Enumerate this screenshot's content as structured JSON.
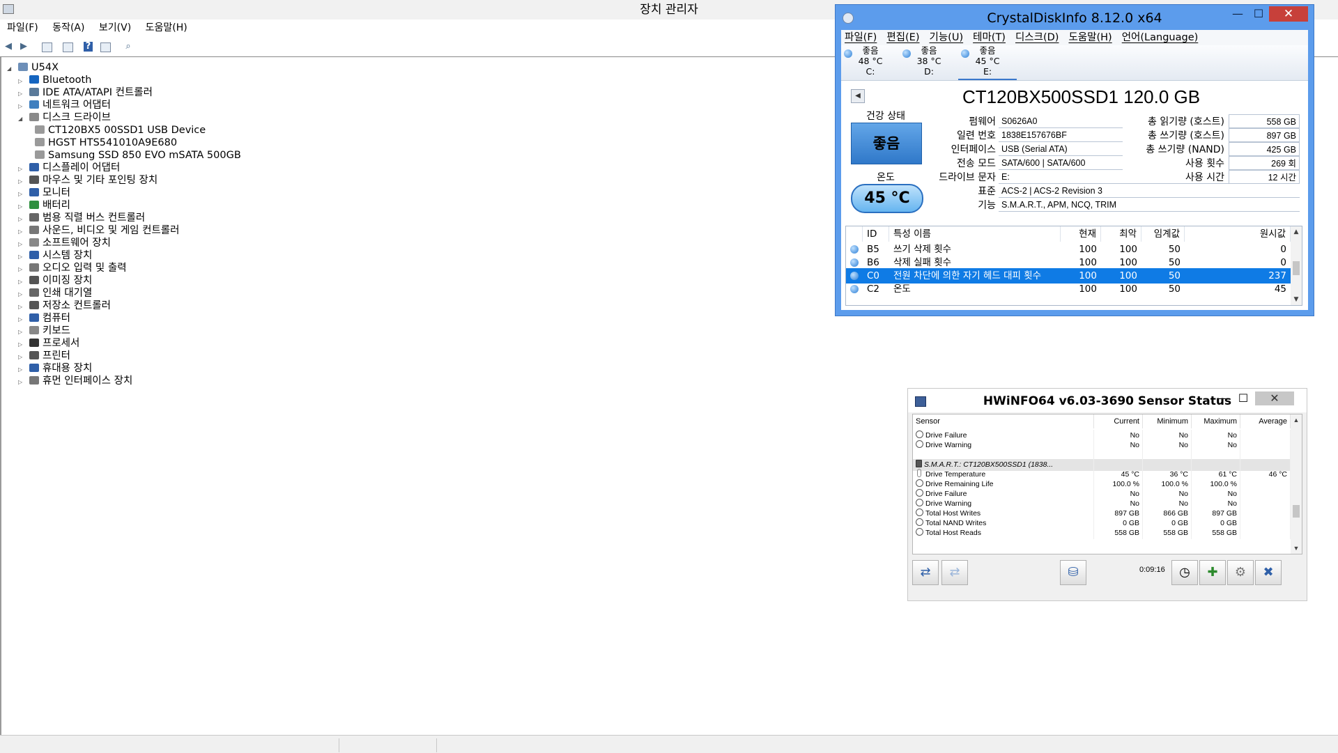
{
  "device_manager": {
    "title": "장치 관리자",
    "menu": [
      "파일(F)",
      "동작(A)",
      "보기(V)",
      "도움말(H)"
    ],
    "tree": [
      {
        "label": "U54X",
        "level": 0,
        "expanded": true,
        "icon": "computer-icon"
      },
      {
        "label": "Bluetooth",
        "level": 1,
        "expanded": false,
        "icon": "bluetooth-icon"
      },
      {
        "label": "IDE ATA/ATAPI 컨트롤러",
        "level": 1,
        "expanded": false,
        "icon": "ide-controller-icon"
      },
      {
        "label": "네트워크 어댑터",
        "level": 1,
        "expanded": false,
        "icon": "network-adapter-icon"
      },
      {
        "label": "디스크 드라이브",
        "level": 1,
        "expanded": true,
        "icon": "disk-drive-icon"
      },
      {
        "label": "CT120BX5 00SSD1 USB Device",
        "level": 2,
        "icon": "disk-icon"
      },
      {
        "label": "HGST HTS541010A9E680",
        "level": 2,
        "icon": "disk-icon"
      },
      {
        "label": "Samsung SSD 850 EVO mSATA 500GB",
        "level": 2,
        "icon": "disk-icon"
      },
      {
        "label": "디스플레이 어댑터",
        "level": 1,
        "expanded": false,
        "icon": "display-adapter-icon"
      },
      {
        "label": "마우스 및 기타 포인팅 장치",
        "level": 1,
        "expanded": false,
        "icon": "mouse-icon"
      },
      {
        "label": "모니터",
        "level": 1,
        "expanded": false,
        "icon": "monitor-icon"
      },
      {
        "label": "배터리",
        "level": 1,
        "expanded": false,
        "icon": "battery-icon"
      },
      {
        "label": "범용 직렬 버스 컨트롤러",
        "level": 1,
        "expanded": false,
        "icon": "usb-icon"
      },
      {
        "label": "사운드, 비디오 및 게임 컨트롤러",
        "level": 1,
        "expanded": false,
        "icon": "sound-icon"
      },
      {
        "label": "소프트웨어 장치",
        "level": 1,
        "expanded": false,
        "icon": "software-device-icon"
      },
      {
        "label": "시스템 장치",
        "level": 1,
        "expanded": false,
        "icon": "system-device-icon"
      },
      {
        "label": "오디오 입력 및 출력",
        "level": 1,
        "expanded": false,
        "icon": "audio-icon"
      },
      {
        "label": "이미징 장치",
        "level": 1,
        "expanded": false,
        "icon": "camera-icon"
      },
      {
        "label": "인쇄 대기열",
        "level": 1,
        "expanded": false,
        "icon": "printer-queue-icon"
      },
      {
        "label": "저장소 컨트롤러",
        "level": 1,
        "expanded": false,
        "icon": "storage-controller-icon"
      },
      {
        "label": "컴퓨터",
        "level": 1,
        "expanded": false,
        "icon": "computer-icon"
      },
      {
        "label": "키보드",
        "level": 1,
        "expanded": false,
        "icon": "keyboard-icon"
      },
      {
        "label": "프로세서",
        "level": 1,
        "expanded": false,
        "icon": "processor-icon"
      },
      {
        "label": "프린터",
        "level": 1,
        "expanded": false,
        "icon": "printer-icon"
      },
      {
        "label": "휴대용 장치",
        "level": 1,
        "expanded": false,
        "icon": "portable-device-icon"
      },
      {
        "label": "휴먼 인터페이스 장치",
        "level": 1,
        "expanded": false,
        "icon": "hid-icon"
      }
    ]
  },
  "crystaldiskinfo": {
    "title": "CrystalDiskInfo 8.12.0 x64",
    "menu": [
      "파일(F)",
      "편집(E)",
      "기능(U)",
      "테마(T)",
      "디스크(D)",
      "도움말(H)",
      "언어(Language)"
    ],
    "disks": [
      {
        "status": "좋음",
        "temp": "48 °C",
        "letter": "C:"
      },
      {
        "status": "좋음",
        "temp": "38 °C",
        "letter": "D:"
      },
      {
        "status": "좋음",
        "temp": "45 °C",
        "letter": "E:"
      }
    ],
    "model": "CT120BX500SSD1 120.0 GB",
    "health_label": "건강 상태",
    "health": "좋음",
    "temp_label": "온도",
    "temp": "45 °C",
    "fields": {
      "firmware_label": "펌웨어",
      "firmware": "S0626A0",
      "serial_label": "일련 번호",
      "serial": "1838E157676BF",
      "interface_label": "인터페이스",
      "interface": "USB (Serial ATA)",
      "transfer_label": "전송 모드",
      "transfer": "SATA/600 | SATA/600",
      "drive_label": "드라이브 문자",
      "drive": "E:",
      "standard_label": "표준",
      "standard": "ACS-2 | ACS-2 Revision 3",
      "features_label": "기능",
      "features": "S.M.A.R.T., APM, NCQ, TRIM",
      "host_reads_label": "총 읽기량 (호스트)",
      "host_reads": "558 GB",
      "host_writes_label": "총 쓰기량 (호스트)",
      "host_writes": "897 GB",
      "nand_writes_label": "총 쓰기량 (NAND)",
      "nand_writes": "425 GB",
      "power_count_label": "사용 횟수",
      "power_count": "269 회",
      "power_hours_label": "사용 시간",
      "power_hours": "12 시간"
    },
    "smart_headers": [
      "ID",
      "특성 이름",
      "현재",
      "최악",
      "임계값",
      "원시값"
    ],
    "smart_rows": [
      {
        "id": "B5",
        "name": "쓰기 삭제 횟수",
        "current": "100",
        "worst": "100",
        "threshold": "50",
        "raw": "0",
        "selected": false
      },
      {
        "id": "B6",
        "name": "삭제 실패 횟수",
        "current": "100",
        "worst": "100",
        "threshold": "50",
        "raw": "0",
        "selected": false
      },
      {
        "id": "C0",
        "name": "전원 차단에 의한 자기 헤드 대피 횟수",
        "current": "100",
        "worst": "100",
        "threshold": "50",
        "raw": "237",
        "selected": true
      },
      {
        "id": "C2",
        "name": "온도",
        "current": "100",
        "worst": "100",
        "threshold": "50",
        "raw": "45",
        "selected": false
      }
    ]
  },
  "hwinfo": {
    "title": "HWiNFO64 v6.03-3690 Sensor Status",
    "headers": [
      "Sensor",
      "Current",
      "Minimum",
      "Maximum",
      "Average"
    ],
    "rows": [
      {
        "type": "item",
        "icon": "status-icon",
        "name": "Drive Failure",
        "current": "No",
        "min": "No",
        "max": "No",
        "avg": ""
      },
      {
        "type": "item",
        "icon": "status-icon",
        "name": "Drive Warning",
        "current": "No",
        "min": "No",
        "max": "No",
        "avg": ""
      },
      {
        "type": "blank",
        "icon": "",
        "name": "",
        "current": "",
        "min": "",
        "max": "",
        "avg": ""
      },
      {
        "type": "group",
        "icon": "drive-icon",
        "name": "S.M.A.R.T.: CT120BX500SSD1 (1838...",
        "current": "",
        "min": "",
        "max": "",
        "avg": ""
      },
      {
        "type": "item",
        "icon": "thermometer-icon",
        "name": "Drive Temperature",
        "current": "45 °C",
        "min": "36 °C",
        "max": "61 °C",
        "avg": "46 °C"
      },
      {
        "type": "item",
        "icon": "status-icon",
        "name": "Drive Remaining Life",
        "current": "100.0 %",
        "min": "100.0 %",
        "max": "100.0 %",
        "avg": ""
      },
      {
        "type": "item",
        "icon": "status-icon",
        "name": "Drive Failure",
        "current": "No",
        "min": "No",
        "max": "No",
        "avg": ""
      },
      {
        "type": "item",
        "icon": "status-icon",
        "name": "Drive Warning",
        "current": "No",
        "min": "No",
        "max": "No",
        "avg": ""
      },
      {
        "type": "item",
        "icon": "status-icon",
        "name": "Total Host Writes",
        "current": "897 GB",
        "min": "866 GB",
        "max": "897 GB",
        "avg": ""
      },
      {
        "type": "item",
        "icon": "status-icon",
        "name": "Total NAND Writes",
        "current": "0 GB",
        "min": "0 GB",
        "max": "0 GB",
        "avg": ""
      },
      {
        "type": "item",
        "icon": "status-icon",
        "name": "Total Host Reads",
        "current": "558 GB",
        "min": "558 GB",
        "max": "558 GB",
        "avg": ""
      }
    ],
    "timer": "0:09:16"
  }
}
